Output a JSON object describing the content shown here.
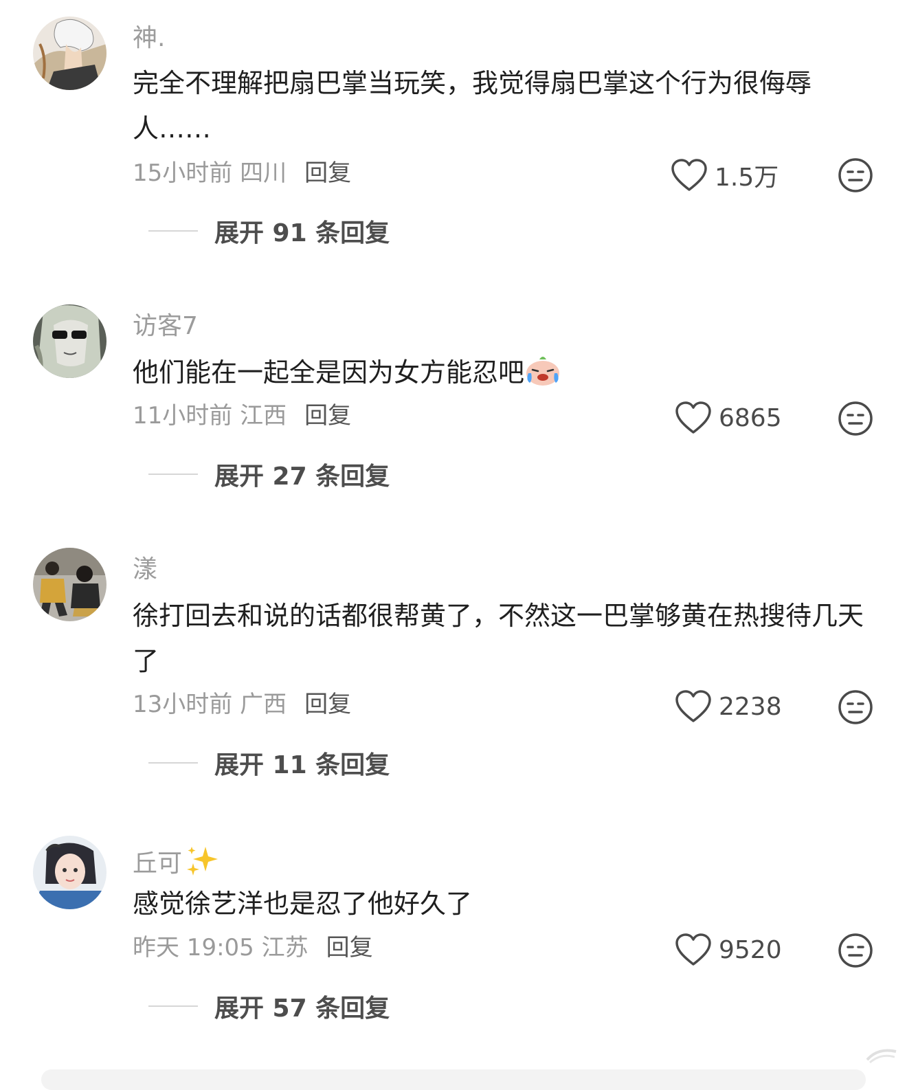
{
  "comments": [
    {
      "username": "神.",
      "text": "完全不理解把扇巴掌当玩笑，我觉得扇巴掌这个行为很侮辱人……",
      "time_location": "15小时前 四川",
      "reply_label": "回复",
      "likes": "1.5万",
      "expand_label": "展开 91 条回复"
    },
    {
      "username": "访客7",
      "text": "他们能在一起全是因为女方能忍吧",
      "time_location": "11小时前 江西",
      "reply_label": "回复",
      "likes": "6865",
      "expand_label": "展开 27 条回复"
    },
    {
      "username": "漾",
      "text": "徐打回去和说的话都很帮黄了，不然这一巴掌够黄在热搜待几天了",
      "time_location": "13小时前 广西",
      "reply_label": "回复",
      "likes": "2238",
      "expand_label": "展开 11 条回复"
    },
    {
      "username": "丘可",
      "text": "感觉徐艺洋也是忍了他好久了",
      "time_location": "昨天 19:05 江苏",
      "reply_label": "回复",
      "likes": "9520",
      "expand_label": "展开 57 条回复"
    }
  ],
  "icons": {
    "like": "heart-outline-icon",
    "dislike": "neutral-face-icon",
    "emoji": "laughing-crying-emoji",
    "sparkle": "sparkles-emoji"
  },
  "colors": {
    "username": "#9c9c9c",
    "text": "#1f1f1f",
    "meta": "#9a9a9a",
    "expand": "#4d4d4d"
  }
}
